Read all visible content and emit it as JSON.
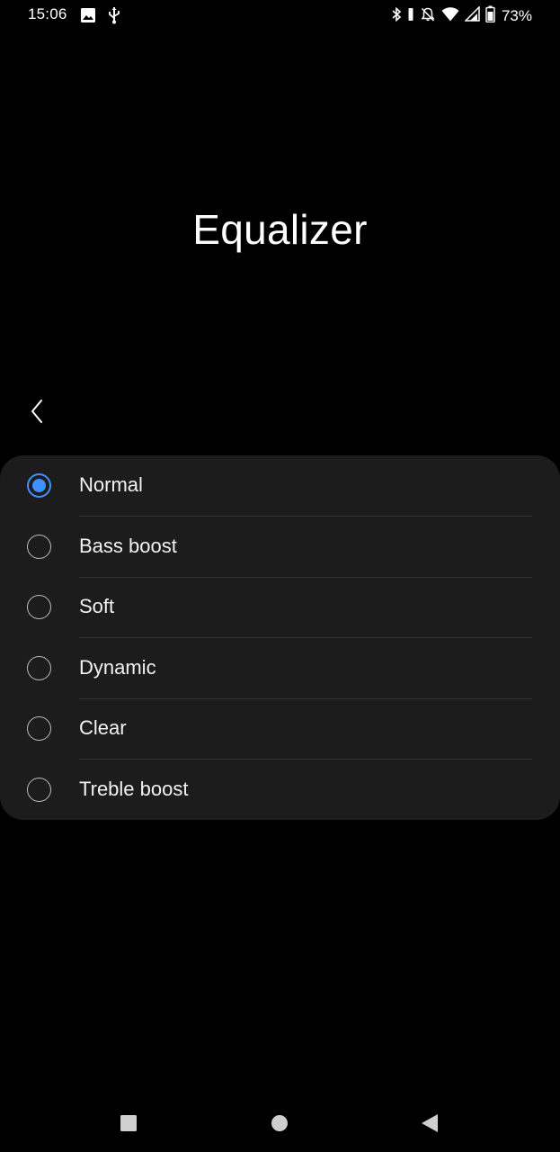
{
  "status_bar": {
    "time": "15:06",
    "battery_percent": "73%",
    "left_icons": [
      "image-icon",
      "usb-icon"
    ],
    "right_icons": [
      "bluetooth-icon",
      "vibrate-icon",
      "mute-icon",
      "wifi-icon",
      "signal-icon",
      "battery-icon"
    ]
  },
  "header": {
    "title": "Equalizer"
  },
  "options": [
    {
      "label": "Normal",
      "selected": true
    },
    {
      "label": "Bass boost",
      "selected": false
    },
    {
      "label": "Soft",
      "selected": false
    },
    {
      "label": "Dynamic",
      "selected": false
    },
    {
      "label": "Clear",
      "selected": false
    },
    {
      "label": "Treble boost",
      "selected": false
    }
  ],
  "nav_bar": {
    "buttons": [
      "recents-icon",
      "home-icon",
      "back-triangle-icon"
    ]
  },
  "colors": {
    "background": "#000000",
    "card": "#1c1c1c",
    "accent": "#3e91ff",
    "text": "#f2f2f2"
  }
}
